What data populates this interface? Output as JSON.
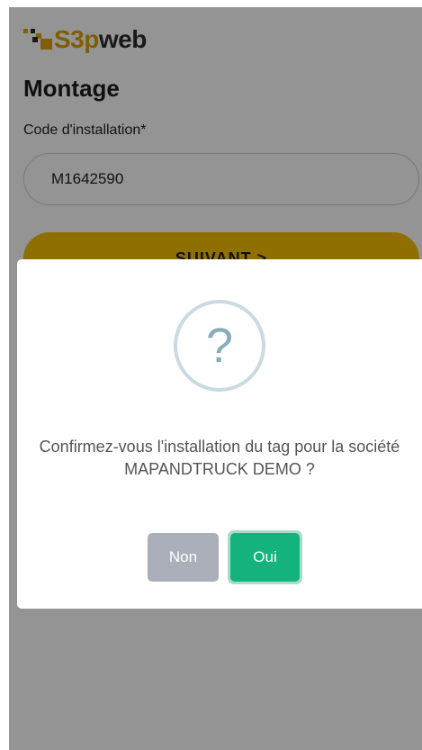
{
  "app": {
    "logo": {
      "part1": "S3",
      "part2": "p",
      "part3": "web"
    }
  },
  "page": {
    "title": "Montage",
    "field_label": "Code d'installation*",
    "code_value": "M1642590",
    "next_label": "SUIVANT >"
  },
  "dialog": {
    "icon": "question-icon",
    "icon_glyph": "?",
    "message": "Confirmez-vous l'installation du tag pour la société MAPANDTRUCK DEMO ?",
    "cancel_label": "Non",
    "confirm_label": "Oui"
  },
  "colors": {
    "brand_yellow": "#f5c000",
    "logo_gold": "#d9a300",
    "confirm_green": "#14b27c",
    "cancel_gray": "#aaafb9",
    "question_blue": "#87adbd"
  }
}
